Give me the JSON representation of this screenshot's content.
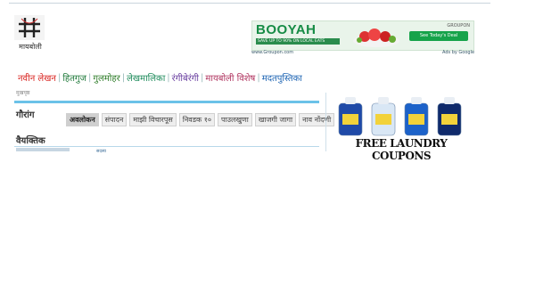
{
  "site": {
    "logo_text": "मायबोली",
    "logo_icon": "hash-grid-logo-icon"
  },
  "ad_banner": {
    "title": "BOOYAH",
    "tag": "GROUPON",
    "subtitle": "SAVE UP TO 90% ON LOCAL EATS",
    "cta": "See Today's Deal",
    "foot_left": "www.Groupon.com",
    "foot_right": "Ads by Google",
    "visual_icon": "food-platter-icon"
  },
  "nav": {
    "items": [
      {
        "label": "नवीन लेखन",
        "color": "#d9231f"
      },
      {
        "label": "हितगुज",
        "color": "#1f7a3a"
      },
      {
        "label": "गुलमोहर",
        "color": "#2f7d2a"
      },
      {
        "label": "लेखमालिका",
        "color": "#1c8a5a"
      },
      {
        "label": "रंगीबेरंगी",
        "color": "#6a3fa0"
      },
      {
        "label": "मायबोली विशेष",
        "color": "#b0345f"
      },
      {
        "label": "मदतपुस्तिका",
        "color": "#1d64b3"
      }
    ]
  },
  "breadcrumb": "मुखपृष्ठ",
  "profile": {
    "name": "गौरांग",
    "tabs": [
      {
        "label": "अवलोकन",
        "active": true
      },
      {
        "label": "संपादन",
        "active": false
      },
      {
        "label": "माझी विचारपूस",
        "active": false
      },
      {
        "label": "निवडक १०",
        "active": false
      },
      {
        "label": "पाउलखुणा",
        "active": false
      },
      {
        "label": "खाजगी जागा",
        "active": false
      },
      {
        "label": "नाव नोंदणी",
        "active": false
      }
    ],
    "section_title": "वैयक्तिक",
    "section_row_label": "सदस्य"
  },
  "laundry_ad": {
    "text": "FREE LAUNDRY COUPONS",
    "bottle_colors": [
      "#1f4aa8",
      "#d9e7f5",
      "#1c62c9",
      "#0f2a6b"
    ],
    "icon": "detergent-bottles-icon"
  }
}
